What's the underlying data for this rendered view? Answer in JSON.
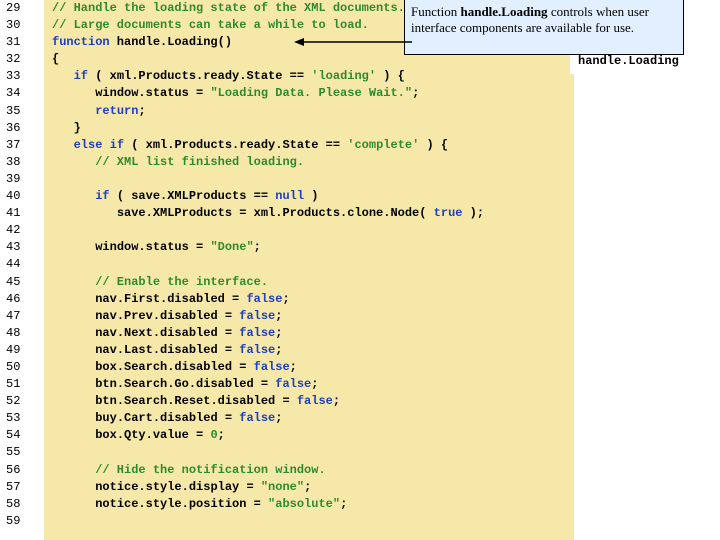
{
  "gutter": {
    "start": 29,
    "end": 59
  },
  "code": {
    "lines": [
      {
        "cls": "c-com",
        "indent": 0,
        "text": "// Handle the loading state of the XML documents."
      },
      {
        "cls": "c-com",
        "indent": 0,
        "text": "// Large documents can take a while to load."
      },
      {
        "segments": [
          {
            "cls": "c-kw",
            "t": "function"
          },
          {
            "cls": "c-def",
            "t": " handle.Loading()"
          }
        ],
        "indent": 0
      },
      {
        "cls": "c-def",
        "indent": 0,
        "text": "{"
      },
      {
        "segments": [
          {
            "cls": "c-kw",
            "t": "if"
          },
          {
            "cls": "c-def",
            "t": " ( xml.Products.ready.State == "
          },
          {
            "cls": "c-str",
            "t": "'loading'"
          },
          {
            "cls": "c-def",
            "t": " ) {"
          }
        ],
        "indent": 1
      },
      {
        "segments": [
          {
            "cls": "c-def",
            "t": "window.status = "
          },
          {
            "cls": "c-str",
            "t": "\"Loading Data. Please Wait.\""
          },
          {
            "cls": "c-def",
            "t": ";"
          }
        ],
        "indent": 2
      },
      {
        "segments": [
          {
            "cls": "c-kw",
            "t": "return"
          },
          {
            "cls": "c-def",
            "t": ";"
          }
        ],
        "indent": 2
      },
      {
        "cls": "c-def",
        "indent": 1,
        "text": "}"
      },
      {
        "segments": [
          {
            "cls": "c-kw",
            "t": "else if"
          },
          {
            "cls": "c-def",
            "t": " ( xml.Products.ready.State == "
          },
          {
            "cls": "c-str",
            "t": "'complete'"
          },
          {
            "cls": "c-def",
            "t": " ) {"
          }
        ],
        "indent": 1
      },
      {
        "cls": "c-com",
        "indent": 2,
        "text": "// XML list finished loading."
      },
      {
        "cls": "c-def",
        "indent": 0,
        "text": ""
      },
      {
        "segments": [
          {
            "cls": "c-kw",
            "t": "if"
          },
          {
            "cls": "c-def",
            "t": " ( save.XMLProducts == "
          },
          {
            "cls": "c-kw",
            "t": "null"
          },
          {
            "cls": "c-def",
            "t": " )"
          }
        ],
        "indent": 2
      },
      {
        "segments": [
          {
            "cls": "c-def",
            "t": "save.XMLProducts = xml.Products.clone.Node( "
          },
          {
            "cls": "c-kw",
            "t": "true"
          },
          {
            "cls": "c-def",
            "t": " );"
          }
        ],
        "indent": 3
      },
      {
        "cls": "c-def",
        "indent": 0,
        "text": ""
      },
      {
        "segments": [
          {
            "cls": "c-def",
            "t": "window.status = "
          },
          {
            "cls": "c-str",
            "t": "\"Done\""
          },
          {
            "cls": "c-def",
            "t": ";"
          }
        ],
        "indent": 2
      },
      {
        "cls": "c-def",
        "indent": 0,
        "text": ""
      },
      {
        "cls": "c-com",
        "indent": 2,
        "text": "// Enable the interface."
      },
      {
        "segments": [
          {
            "cls": "c-def",
            "t": "nav.First.disabled = "
          },
          {
            "cls": "c-kw",
            "t": "false"
          },
          {
            "cls": "c-def",
            "t": ";"
          }
        ],
        "indent": 2
      },
      {
        "segments": [
          {
            "cls": "c-def",
            "t": "nav.Prev.disabled = "
          },
          {
            "cls": "c-kw",
            "t": "false"
          },
          {
            "cls": "c-def",
            "t": ";"
          }
        ],
        "indent": 2
      },
      {
        "segments": [
          {
            "cls": "c-def",
            "t": "nav.Next.disabled = "
          },
          {
            "cls": "c-kw",
            "t": "false"
          },
          {
            "cls": "c-def",
            "t": ";"
          }
        ],
        "indent": 2
      },
      {
        "segments": [
          {
            "cls": "c-def",
            "t": "nav.Last.disabled = "
          },
          {
            "cls": "c-kw",
            "t": "false"
          },
          {
            "cls": "c-def",
            "t": ";"
          }
        ],
        "indent": 2
      },
      {
        "segments": [
          {
            "cls": "c-def",
            "t": "box.Search.disabled = "
          },
          {
            "cls": "c-kw",
            "t": "false"
          },
          {
            "cls": "c-def",
            "t": ";"
          }
        ],
        "indent": 2
      },
      {
        "segments": [
          {
            "cls": "c-def",
            "t": "btn.Search.Go.disabled = "
          },
          {
            "cls": "c-kw",
            "t": "false"
          },
          {
            "cls": "c-def",
            "t": ";"
          }
        ],
        "indent": 2
      },
      {
        "segments": [
          {
            "cls": "c-def",
            "t": "btn.Search.Reset.disabled = "
          },
          {
            "cls": "c-kw",
            "t": "false"
          },
          {
            "cls": "c-def",
            "t": ";"
          }
        ],
        "indent": 2
      },
      {
        "segments": [
          {
            "cls": "c-def",
            "t": "buy.Cart.disabled = "
          },
          {
            "cls": "c-kw",
            "t": "false"
          },
          {
            "cls": "c-def",
            "t": ";"
          }
        ],
        "indent": 2
      },
      {
        "segments": [
          {
            "cls": "c-def",
            "t": "box.Qty.value = "
          },
          {
            "cls": "c-str",
            "t": "0"
          },
          {
            "cls": "c-def",
            "t": ";"
          }
        ],
        "indent": 2
      },
      {
        "cls": "c-def",
        "indent": 0,
        "text": ""
      },
      {
        "cls": "c-com",
        "indent": 2,
        "text": "// Hide the notification window."
      },
      {
        "segments": [
          {
            "cls": "c-def",
            "t": "notice.style.display = "
          },
          {
            "cls": "c-str",
            "t": "\"none\""
          },
          {
            "cls": "c-def",
            "t": ";"
          }
        ],
        "indent": 2
      },
      {
        "segments": [
          {
            "cls": "c-def",
            "t": "notice.style.position = "
          },
          {
            "cls": "c-str",
            "t": "\"absolute\""
          },
          {
            "cls": "c-def",
            "t": ";"
          }
        ],
        "indent": 2
      },
      {
        "cls": "c-def",
        "indent": 0,
        "text": ""
      }
    ]
  },
  "callout": {
    "prefix": "Function ",
    "bold": "handle.Loading",
    "suffix": " controls when user interface components are available for use."
  },
  "rightLabel": {
    "text": "handle.Loading"
  }
}
